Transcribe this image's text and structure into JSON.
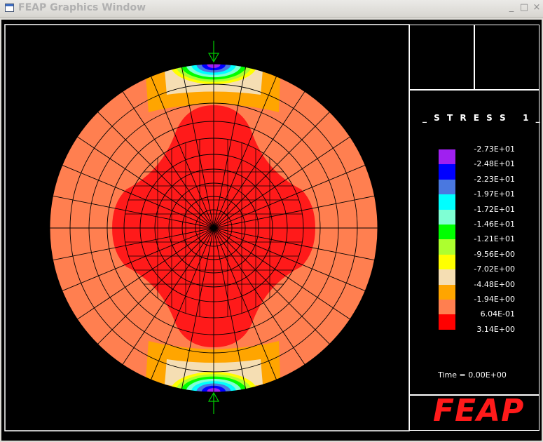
{
  "window": {
    "title": "FEAP Graphics Window",
    "controls": {
      "minimize": "_",
      "maximize": "□",
      "close": "×"
    }
  },
  "legend": {
    "title": "_ S T R E S S   1 _",
    "entries": [
      {
        "label": "-2.73E+01",
        "color": "#a020f0"
      },
      {
        "label": "-2.48E+01",
        "color": "#0000ff"
      },
      {
        "label": "-2.23E+01",
        "color": "#4a78e0"
      },
      {
        "label": "-1.97E+01",
        "color": "#00ffff"
      },
      {
        "label": "-1.72E+01",
        "color": "#7fffd4"
      },
      {
        "label": "-1.46E+01",
        "color": "#00ff00"
      },
      {
        "label": "-1.21E+01",
        "color": "#adff2f"
      },
      {
        "label": "-9.56E+00",
        "color": "#ffff00"
      },
      {
        "label": "-7.02E+00",
        "color": "#f5deb3"
      },
      {
        "label": "-4.48E+00",
        "color": "#ffa500"
      },
      {
        "label": "-1.94E+00",
        "color": "#ff7f50"
      },
      {
        "label": "6.04E-01",
        "color": "#ff0000"
      },
      {
        "label": "3.14E+00",
        "color": "#ff0000"
      }
    ]
  },
  "time_label": "Time = 0.00E+00",
  "logo_text": "FEAP",
  "colors": {
    "background": "#000000",
    "mesh_lines": "#000000",
    "outer_region": "#ff7f50",
    "core_region": "#ff1a1a",
    "load_arrow": "#00cc00",
    "logo": "#ff1a1a"
  }
}
